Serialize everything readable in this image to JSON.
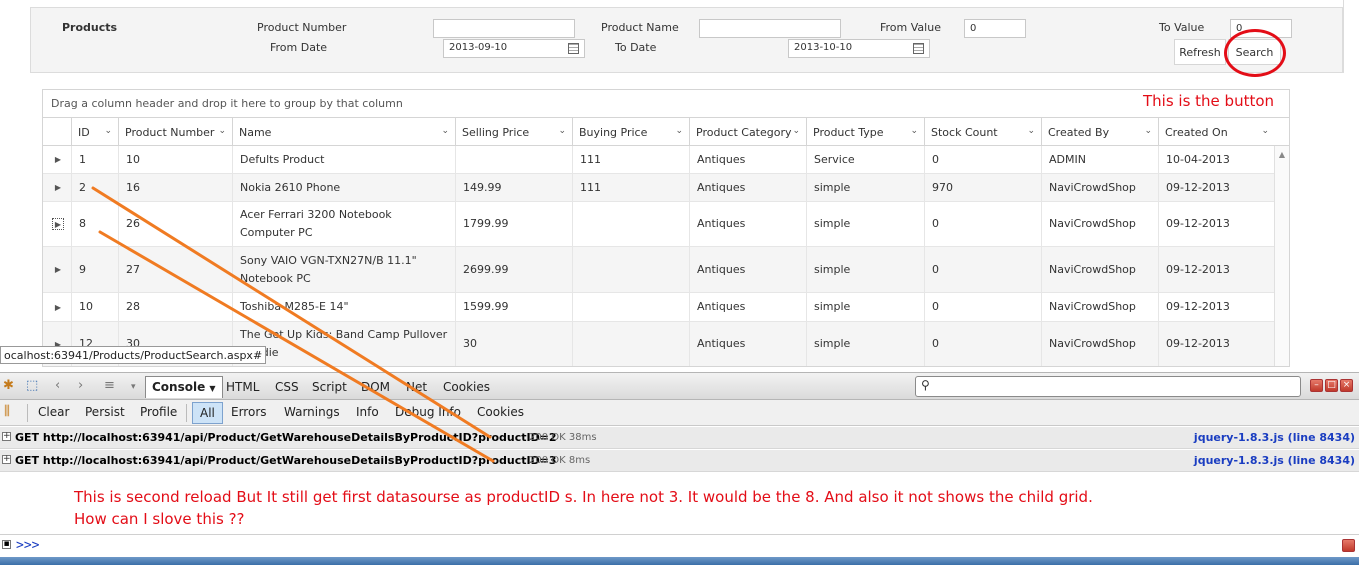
{
  "filter": {
    "products_label": "Products",
    "product_number_label": "Product Number",
    "product_number_value": "",
    "product_name_label": "Product Name",
    "product_name_value": "",
    "from_value_label": "From Value",
    "from_value": "0",
    "to_value_label": "To Value",
    "to_value": "0",
    "from_date_label": "From Date",
    "from_date": "2013-09-10",
    "to_date_label": "To Date",
    "to_date": "2013-10-10",
    "refresh_label": "Refresh",
    "search_label": "Search"
  },
  "annotations": {
    "button_note": "This is the button",
    "bottom_note_line1": "This is second reload But It still get first datasourse as productID s. In here not 3. It would be the 8. And also it not shows the child grid.",
    "bottom_note_line2": "How can I slove this ??"
  },
  "grid": {
    "group_bar_text": "Drag a column header and drop it here to group by that column",
    "columns": [
      "ID",
      "Product Number",
      "Name",
      "Selling Price",
      "Buying Price",
      "Product Category",
      "Product Type",
      "Stock Count",
      "Created By",
      "Created On"
    ],
    "rows": [
      [
        "1",
        "10",
        "Defults Product",
        "",
        "111",
        "Antiques",
        "Service",
        "0",
        "ADMIN",
        "10-04-2013"
      ],
      [
        "2",
        "16",
        "Nokia 2610 Phone",
        "149.99",
        "111",
        "Antiques",
        "simple",
        "970",
        "NaviCrowdShop",
        "09-12-2013"
      ],
      [
        "8",
        "26",
        "Acer Ferrari 3200 Notebook Computer PC",
        "1799.99",
        "",
        "Antiques",
        "simple",
        "0",
        "NaviCrowdShop",
        "09-12-2013"
      ],
      [
        "9",
        "27",
        "Sony VAIO VGN-TXN27N/B 11.1\" Notebook PC",
        "2699.99",
        "",
        "Antiques",
        "simple",
        "0",
        "NaviCrowdShop",
        "09-12-2013"
      ],
      [
        "10",
        "28",
        "Toshiba M285-E 14\"",
        "1599.99",
        "",
        "Antiques",
        "simple",
        "0",
        "NaviCrowdShop",
        "09-12-2013"
      ],
      [
        "12",
        "30",
        "The Get Up Kids: Band Camp Pullover Hoodie",
        "30",
        "",
        "Antiques",
        "simple",
        "0",
        "NaviCrowdShop",
        "09-12-2013"
      ]
    ]
  },
  "status_url": "ocalhost:63941/Products/ProductSearch.aspx#",
  "firebug": {
    "console_label": "Console",
    "tabs": [
      "HTML",
      "CSS",
      "Script",
      "DOM",
      "Net",
      "Cookies"
    ],
    "toolbar_buttons": [
      "Clear",
      "Persist",
      "Profile"
    ],
    "filters": [
      "All",
      "Errors",
      "Warnings",
      "Info",
      "Debug Info",
      "Cookies"
    ],
    "log": [
      {
        "request": "GET http://localhost:63941/api/Product/GetWarehouseDetailsByProductID?productID=2",
        "status": "200 OK 38ms",
        "source": "jquery-1.8.3.js (line 8434)"
      },
      {
        "request": "GET http://localhost:63941/api/Product/GetWarehouseDetailsByProductID?productID=3",
        "status": "200 OK 8ms",
        "source": "jquery-1.8.3.js (line 8434)"
      }
    ],
    "prompt": ">>>"
  },
  "colors": {
    "annotation_red": "#e30d17",
    "arrow_orange": "#f07b22",
    "link_blue": "#1a3dc1"
  }
}
